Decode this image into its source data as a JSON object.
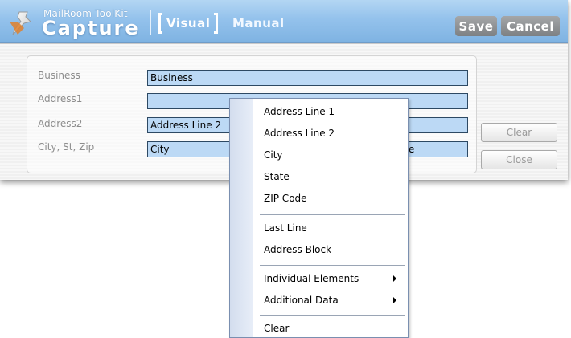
{
  "app": {
    "brand_small": "MailRoom ToolKit",
    "brand_large": "Capture"
  },
  "toolbar": {
    "mode_active": "Visual",
    "mode_other": "Manual",
    "save_label": "Save",
    "cancel_label": "Cancel"
  },
  "form": {
    "fields": [
      {
        "label": "Business",
        "value": "Business"
      },
      {
        "label": "Address1",
        "value": ""
      },
      {
        "label": "Address2",
        "value": "Address Line 2"
      },
      {
        "label": "City, St, Zip",
        "value": "City",
        "value_tail": "e"
      }
    ],
    "clear_label": "Clear",
    "close_label": "Close"
  },
  "context_menu": {
    "items": [
      {
        "label": "Address Line 1"
      },
      {
        "label": "Address Line 2"
      },
      {
        "label": "City"
      },
      {
        "label": "State"
      },
      {
        "label": "ZIP Code"
      },
      {
        "label": "Last Line"
      },
      {
        "label": "Address Block"
      },
      {
        "label": "Individual Elements",
        "submenu": true
      },
      {
        "label": "Additional Data",
        "submenu": true
      },
      {
        "label": "Clear"
      }
    ]
  },
  "icons": {
    "logo": "pushpin-icon",
    "submenu": "chevron-right-icon"
  },
  "colors": {
    "titlebar": "#94c2ec",
    "input_bg": "#bcd9f5",
    "title_button": "#8a8d90"
  }
}
